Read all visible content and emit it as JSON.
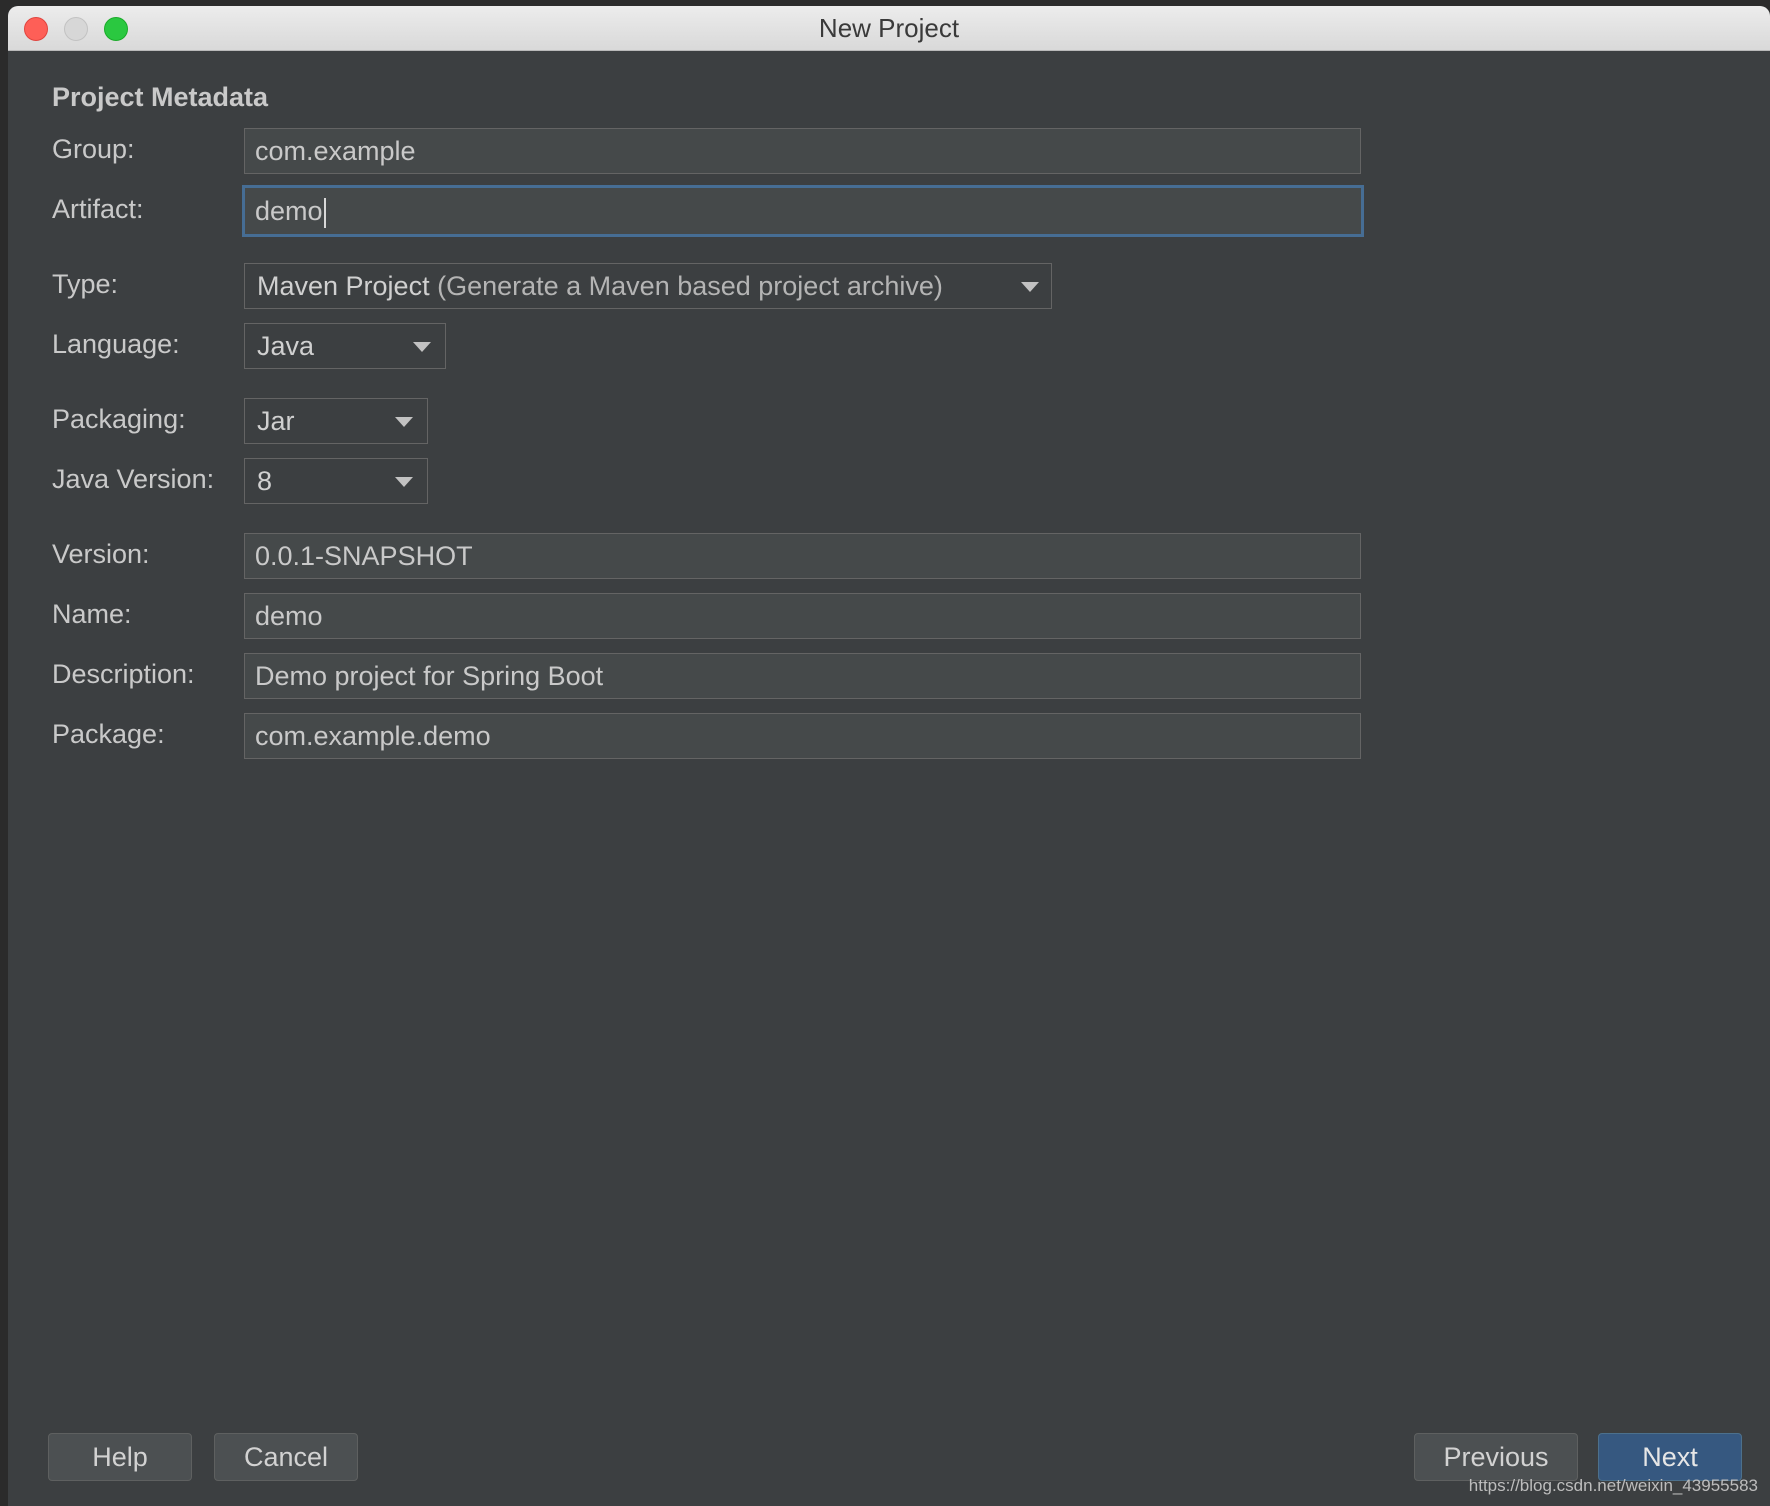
{
  "window": {
    "title": "New Project"
  },
  "section": {
    "title": "Project Metadata"
  },
  "form": {
    "group": {
      "label": "Group:",
      "value": "com.example"
    },
    "artifact": {
      "label": "Artifact:",
      "value": "demo"
    },
    "type": {
      "label": "Type:",
      "value": "Maven Project",
      "hint": "(Generate a Maven based project archive)"
    },
    "language": {
      "label": "Language:",
      "value": "Java"
    },
    "packaging": {
      "label": "Packaging:",
      "value": "Jar"
    },
    "java_version": {
      "label": "Java Version:",
      "value": "8"
    },
    "version": {
      "label": "Version:",
      "value": "0.0.1-SNAPSHOT"
    },
    "name": {
      "label": "Name:",
      "value": "demo"
    },
    "description": {
      "label": "Description:",
      "value": "Demo project for Spring Boot"
    },
    "package": {
      "label": "Package:",
      "value": "com.example.demo"
    }
  },
  "buttons": {
    "help": "Help",
    "cancel": "Cancel",
    "previous": "Previous",
    "next": "Next"
  },
  "watermark": "https://blog.csdn.net/weixin_43955583",
  "colors": {
    "background": "#3c3f41",
    "field_background": "#45494a",
    "focus_border": "#466d94",
    "primary_button": "#365880"
  }
}
